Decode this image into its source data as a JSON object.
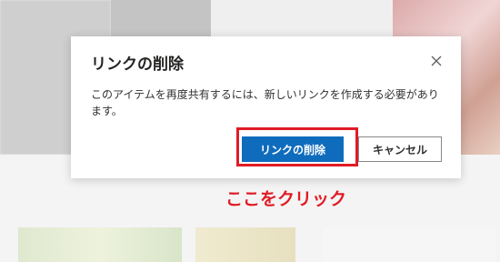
{
  "dialog": {
    "title": "リンクの削除",
    "message": "このアイテムを再度共有するには、新しいリンクを作成する必要があります。",
    "primary_button": "リンクの削除",
    "secondary_button": "キャンセル",
    "close_icon": "close-icon"
  },
  "annotation": {
    "text": "ここをクリック",
    "color": "#e01b24"
  },
  "colors": {
    "primary": "#0f6cbd",
    "highlight": "#e01b24"
  }
}
